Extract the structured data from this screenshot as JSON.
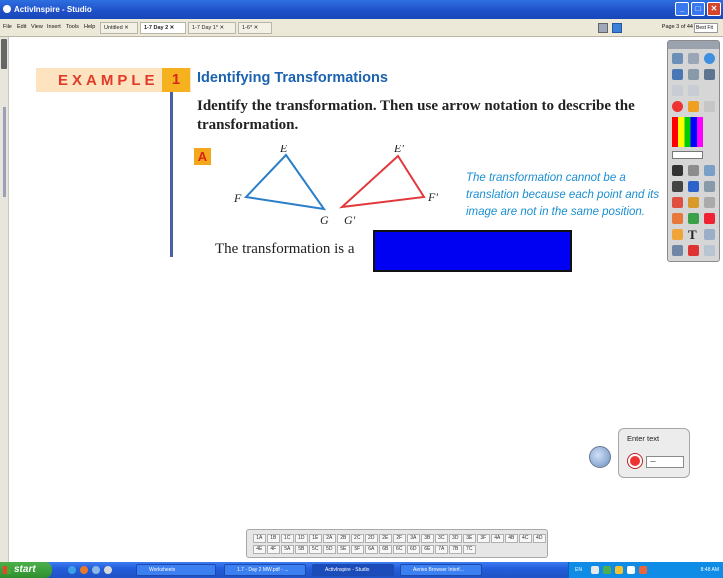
{
  "window": {
    "title": "ActivInspire - Studio"
  },
  "menu": [
    "File",
    "Edit",
    "View",
    "Insert",
    "Tools",
    "Help"
  ],
  "doc_tabs": [
    "Untitled",
    "1-7 Day 2",
    "1-7 Day 1*",
    "1-6*"
  ],
  "page_info": "Page 3 of 44",
  "zoom": "Best Fit",
  "slide": {
    "example_word": "EXAMPLE",
    "example_number": "1",
    "heading": "Identifying Transformations",
    "instruction": "Identify the transformation. Then use arrow notation to describe the transformation.",
    "part_label": "A",
    "figure_labels": {
      "pre": [
        "E",
        "F",
        "G"
      ],
      "image": [
        "E'",
        "F'",
        "G'"
      ]
    },
    "note": "The transformation cannot be a translation because each point and its image are not in the same position.",
    "answer_prefix": "The transformation is a",
    "answer_box_color": "#0000f2"
  },
  "text_widget": {
    "label": "Enter text"
  },
  "page_buttons": [
    "1A",
    "1B",
    "1C",
    "1D",
    "1E",
    "2A",
    "2B",
    "2C",
    "2D",
    "2E",
    "2F",
    "3A",
    "3B",
    "3C",
    "3D",
    "3E",
    "3F",
    "4A",
    "4B",
    "4C",
    "4D",
    "4E",
    "4F",
    "5A",
    "5B",
    "5C",
    "5D",
    "5E",
    "5F",
    "6A",
    "6B",
    "6C",
    "6D",
    "6E",
    "7A",
    "7B",
    "7C"
  ],
  "taskbar": {
    "start": "start",
    "tasks": [
      "Worksheets",
      "1.7 - Day 2 MW.pdf - ...",
      "ActivInspire - Studio",
      "Aeries Browser Interf..."
    ],
    "clock": "8:48 AM",
    "tray_lang": "EN"
  }
}
